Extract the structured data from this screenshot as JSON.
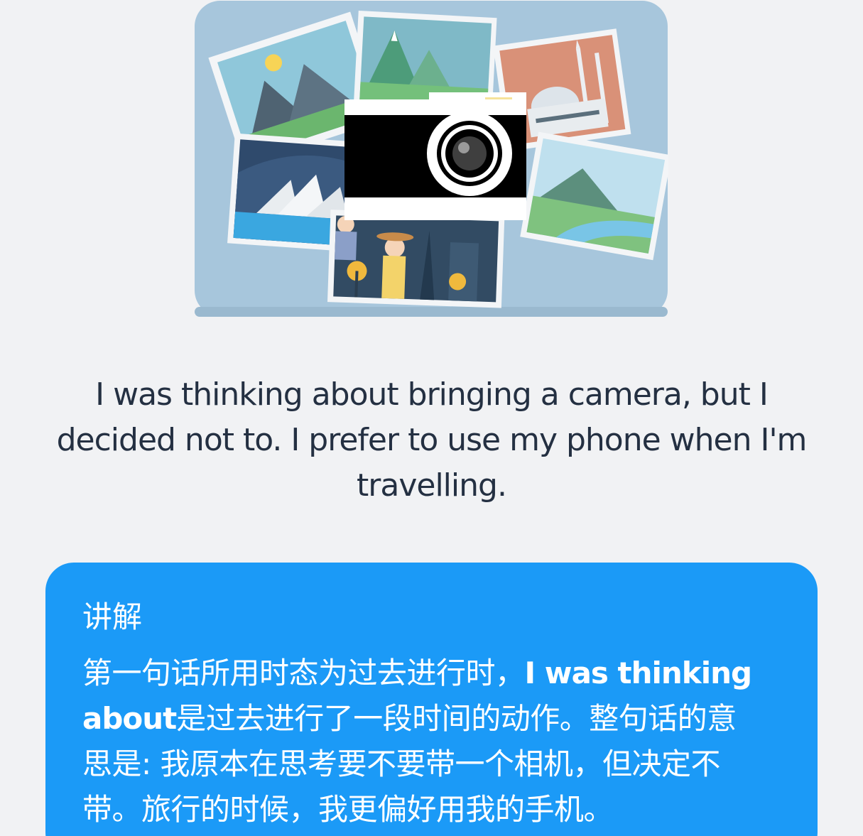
{
  "illustration": {
    "icon": "camera-with-travel-photos"
  },
  "sentence": {
    "text": "I was thinking about bringing a camera, but I decided not to. I prefer to use my phone when I'm travelling."
  },
  "explanation": {
    "title": "讲解",
    "part1": "第一句话所用时态为过去进行时，",
    "highlight": "I was thinking about",
    "part2": "是过去进行了一段时间的动作。整句话的意思是: 我原本在思考要不要带一个相机，但决定不带。旅行的时候，我更偏好用我的手机。"
  },
  "colors": {
    "background": "#f1f2f4",
    "card": "#1b9af7",
    "text_dark": "#243042"
  }
}
